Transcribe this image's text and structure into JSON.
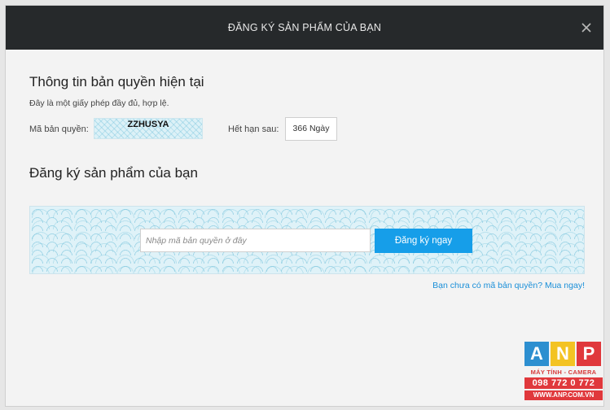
{
  "dialog": {
    "title": "ĐĂNG KÝ SẢN PHẨM CỦA BẠN",
    "close_icon": "close-icon"
  },
  "license": {
    "heading": "Thông tin bản quyền hiện tại",
    "description": "Đây là một giấy phép đầy đủ, hợp lệ.",
    "key_label": "Mã bản quyền:",
    "key_value": "ZZHUSYA",
    "expiry_label": "Hết hạn sau:",
    "expiry_value": "366 Ngày"
  },
  "register": {
    "heading": "Đăng ký sản phẩm của bạn",
    "input_value": "",
    "input_placeholder": "Nhập mã bản quyền ở đây",
    "button_label": "Đăng ký ngay",
    "buy_link": "Bạn chưa có mã bản quyền? Mua ngay!"
  },
  "watermark": {
    "letters": [
      "A",
      "N",
      "P"
    ],
    "tagline": "MÁY TÍNH - CAMERA",
    "phone": "098 772 0 772",
    "website": "WWW.ANP.COM.VN"
  },
  "colors": {
    "titlebar": "#26292b",
    "accent": "#169ee9",
    "link": "#1a8fd8"
  }
}
